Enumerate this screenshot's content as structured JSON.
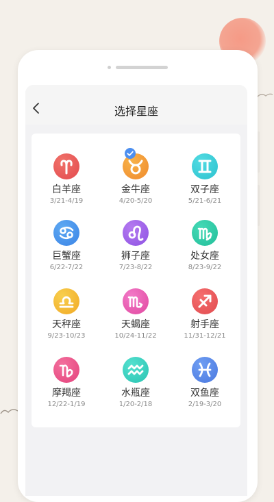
{
  "header": {
    "title": "选择星座",
    "back_icon": "chevron-left-icon"
  },
  "zodiac": [
    {
      "name": "白羊座",
      "dates": "3/21-4/19",
      "icon": "aries-icon",
      "color_a": "#f0726a",
      "color_b": "#e34a4e",
      "selected": false
    },
    {
      "name": "金牛座",
      "dates": "4/20-5/20",
      "icon": "taurus-icon",
      "color_a": "#f7b24a",
      "color_b": "#f08a2c",
      "selected": true
    },
    {
      "name": "双子座",
      "dates": "5/21-6/21",
      "icon": "gemini-icon",
      "color_a": "#52dbe2",
      "color_b": "#2cc2cf",
      "selected": false
    },
    {
      "name": "巨蟹座",
      "dates": "6/22-7/22",
      "icon": "cancer-icon",
      "color_a": "#5ea9f2",
      "color_b": "#3b84e6",
      "selected": false
    },
    {
      "name": "狮子座",
      "dates": "7/23-8/22",
      "icon": "leo-icon",
      "color_a": "#b57af0",
      "color_b": "#8d52e3",
      "selected": false
    },
    {
      "name": "处女座",
      "dates": "8/23-9/22",
      "icon": "virgo-icon",
      "color_a": "#45d9b6",
      "color_b": "#22bf9a",
      "selected": false
    },
    {
      "name": "天秤座",
      "dates": "9/23-10/23",
      "icon": "libra-icon",
      "color_a": "#f8cf4e",
      "color_b": "#f1a925",
      "selected": false
    },
    {
      "name": "天蝎座",
      "dates": "10/24-11/22",
      "icon": "scorpio-icon",
      "color_a": "#f27bc8",
      "color_b": "#e1479f",
      "selected": false
    },
    {
      "name": "射手座",
      "dates": "11/31-12/21",
      "icon": "sagittarius-icon",
      "color_a": "#f56e6e",
      "color_b": "#e14b4f",
      "selected": false
    },
    {
      "name": "摩羯座",
      "dates": "12/22-1/19",
      "icon": "capricorn-icon",
      "color_a": "#f3709d",
      "color_b": "#e4427c",
      "selected": false
    },
    {
      "name": "水瓶座",
      "dates": "1/20-2/18",
      "icon": "aquarius-icon",
      "color_a": "#55e0cf",
      "color_b": "#29c4b2",
      "selected": false
    },
    {
      "name": "双鱼座",
      "dates": "2/19-3/20",
      "icon": "pisces-icon",
      "color_a": "#6f9ef2",
      "color_b": "#4a78e0",
      "selected": false
    }
  ]
}
